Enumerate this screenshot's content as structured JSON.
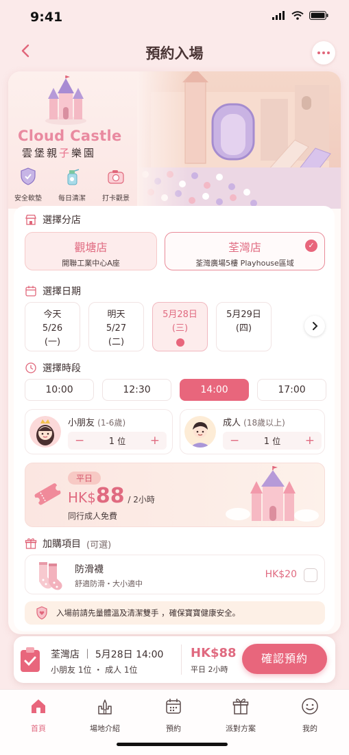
{
  "status": {
    "time": "9:41"
  },
  "header": {
    "title": "預約入場"
  },
  "brand": {
    "name_en": "Cloud Castle",
    "name_zh_pre": "雲堡親",
    "name_zh_pink": "子",
    "name_zh_post": "樂園"
  },
  "features": [
    {
      "label": "安全軟墊",
      "icon": "shield-icon"
    },
    {
      "label": "每日清潔",
      "icon": "spray-icon"
    },
    {
      "label": "打卡觀景",
      "icon": "camera-icon"
    }
  ],
  "store": {
    "title": "選擇分店",
    "options": [
      {
        "name": "觀塘店",
        "address": "開聯工業中心A座",
        "selected": false
      },
      {
        "name": "荃灣店",
        "address": "荃灣廣場5樓 Playhouse區域",
        "selected": true
      }
    ]
  },
  "date": {
    "title": "選擇日期",
    "options": [
      {
        "l1": "今天",
        "l2": "5/26",
        "l3": "(一)"
      },
      {
        "l1": "明天",
        "l2": "5/27",
        "l3": "(二)"
      },
      {
        "l1": "5月28日",
        "l2": "(三)",
        "l3": "",
        "selected": true
      },
      {
        "l1": "5月29日",
        "l2": "(四)",
        "l3": ""
      }
    ]
  },
  "time": {
    "title": "選擇時段",
    "slots": [
      "10:00",
      "12:30",
      "14:00",
      "17:00"
    ],
    "selected": "14:00"
  },
  "guests": {
    "kid": {
      "label": "小朋友",
      "range": "(1-6歲)",
      "count": "1",
      "unit": "位"
    },
    "adult": {
      "label": "成人",
      "range": "(18歲以上)",
      "count": "1",
      "unit": "位"
    },
    "minus": "−",
    "plus": "+"
  },
  "price": {
    "badge": "平日",
    "currency": "HK$",
    "amount": "88",
    "per": "/ 2小時",
    "note": "同行成人免費"
  },
  "addons": {
    "title": "加購項目",
    "optional": "(可選)",
    "items": [
      {
        "name": "防滑襪",
        "desc": "舒適防滑・大小適中",
        "price": "HK$20",
        "checked": false
      }
    ]
  },
  "notice": "入場前請先量體溫及清潔雙手 ，確保寶寶健康安全。",
  "summary": {
    "line1": "荃灣店 ｜ 5月28日 14:00",
    "line2": "小朋友 1位 ・ 成人 1位",
    "total": "HK$88",
    "total_note": "平日 2小時",
    "cta": "確認預約"
  },
  "tabs": [
    {
      "label": "首頁",
      "icon": "home-icon",
      "active": true
    },
    {
      "label": "場地介紹",
      "icon": "castle-icon",
      "active": false
    },
    {
      "label": "預約",
      "icon": "calendar-icon",
      "active": false
    },
    {
      "label": "派對方案",
      "icon": "gift-icon",
      "active": false
    },
    {
      "label": "我的",
      "icon": "smile-icon",
      "active": false
    }
  ],
  "colors": {
    "accent": "#e8667c",
    "background": "#fbeaea",
    "brand": "#e98aa0"
  }
}
